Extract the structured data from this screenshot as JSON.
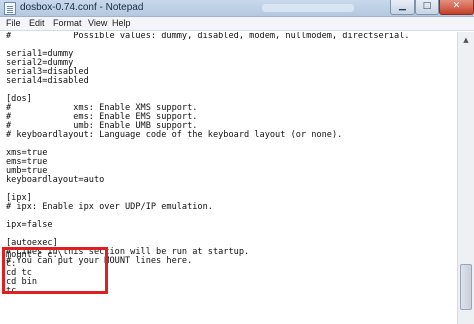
{
  "window": {
    "title": "dosbox-0.74.conf - Notepad",
    "minimize_symbol": "▁",
    "maximize_symbol": "□",
    "close_symbol": "✕"
  },
  "menu": [
    "File",
    "Edit",
    "Format",
    "View",
    "Help"
  ],
  "editor": {
    "lines": [
      "#            Possible values: dummy, disabled, modem, nullmodem, directserial.",
      "",
      "serial1=dummy",
      "serial2=dummy",
      "serial3=disabled",
      "serial4=disabled",
      "",
      "[dos]",
      "#            xms: Enable XMS support.",
      "#            ems: Enable EMS support.",
      "#            umb: Enable UMB support.",
      "# keyboardlayout: Language code of the keyboard layout (or none).",
      "",
      "xms=true",
      "ems=true",
      "umb=true",
      "keyboardlayout=auto",
      "",
      "[ipx]",
      "# ipx: Enable ipx over UDP/IP emulation.",
      "",
      "ipx=false",
      "",
      "[autoexec]",
      "# Lines in this section will be run at startup.",
      "# You can put your MOUNT lines here.",
      "",
      "",
      "mount c c:\\",
      "c:",
      "cd tc",
      "cd bin",
      "tc"
    ]
  },
  "scrollbar": {
    "up_arrow": "▲"
  },
  "colors": {
    "highlight": "#e02020",
    "titlebar": "#c9d9ec",
    "text": "#111111"
  }
}
